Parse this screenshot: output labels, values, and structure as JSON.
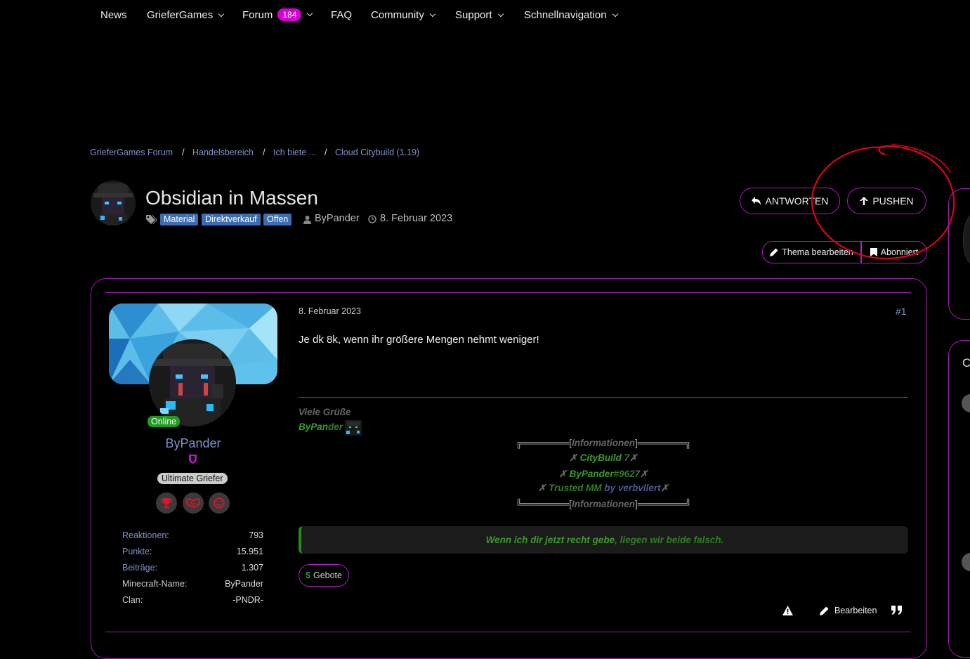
{
  "nav": {
    "items": [
      {
        "label": "News",
        "dropdown": false
      },
      {
        "label": "GrieferGames",
        "dropdown": true
      },
      {
        "label": "Forum",
        "dropdown": true,
        "badge": "184"
      },
      {
        "label": "FAQ",
        "dropdown": false
      },
      {
        "label": "Community",
        "dropdown": true
      },
      {
        "label": "Support",
        "dropdown": true
      },
      {
        "label": "Schnellnavigation",
        "dropdown": true
      }
    ]
  },
  "breadcrumb": [
    "GrieferGames Forum",
    "Handelsbereich",
    "Ich biete ...",
    "Cloud Citybuild (1.19)"
  ],
  "breadcrumb_separator": "/",
  "thread": {
    "title": "Obsidian in Massen",
    "tags": [
      "Material",
      "Direktverkauf",
      "Offen"
    ],
    "author": "ByPander",
    "date": "8. Februar 2023",
    "reply_label": "ANTWORTEN",
    "push_label": "PUSHEN",
    "edit_thread_label": "Thema bearbeiten",
    "subscribed_label": "Abonniert"
  },
  "post": {
    "date": "8. Februar 2023",
    "number": "#1",
    "text": "Je dk 8k, wenn ihr größere Mengen nehmt weniger!",
    "user": {
      "name": "ByPander",
      "online_label": "Online",
      "rank": "Ultimate Griefer",
      "stats": [
        {
          "label": "Reaktionen",
          "value": "793",
          "link": true
        },
        {
          "label": "Punkte",
          "value": "15.951",
          "link": true
        },
        {
          "label": "Beiträge",
          "value": "1.307",
          "link": true
        },
        {
          "label": "Minecraft-Name",
          "value": "ByPander",
          "link": false
        },
        {
          "label": "Clan",
          "value": "-PNDR-",
          "link": false
        }
      ]
    },
    "signature": {
      "greeting": "Viele Grüße",
      "name_a": "ByPan",
      "name_b": "der",
      "box_top_a": "╔═══════[",
      "box_top_b": "Informationen",
      "box_top_c": "]═══════╗",
      "line1_a": "✗ ",
      "line1_b": "CityBuild",
      "line1_c": " 7",
      "line1_d": "✗",
      "line2_a": "✗ ",
      "line2_b": "ByPander",
      "line2_c": "#9627",
      "line2_d": "✗",
      "line3_a": "✗ ",
      "line3_b": "Trusted MM",
      "line3_c": " by verbvllert",
      "line3_d": "✗",
      "box_bottom_a": "╚═══════[",
      "box_bottom_b": "Informationen",
      "box_bottom_c": "]═══════╝",
      "quote_a": "Wenn ich dir jetzt recht gebe",
      "quote_b": ", liegen wir beide falsch."
    },
    "offers_label": "Gebote",
    "offers_icon": "$",
    "edit_label": "Bearbeiten"
  },
  "right_panel": {
    "partial_letter": "C"
  },
  "colors": {
    "accent": "#b419c2",
    "tag": "#3b6db0",
    "link": "#7f93c8",
    "online": "#1f9d1f",
    "badge": "#d400d4",
    "annotation": "#e0001a"
  }
}
